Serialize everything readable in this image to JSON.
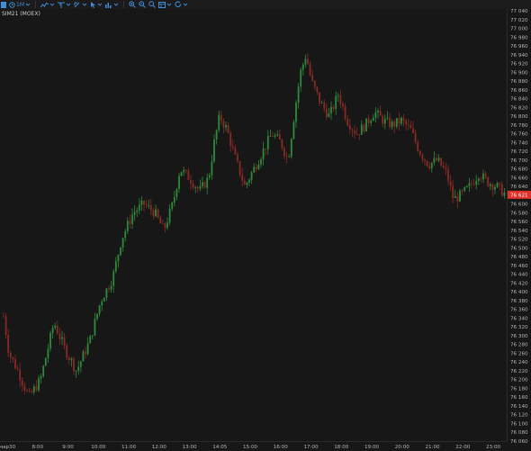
{
  "toolbar": {
    "timeframe_label": "1M",
    "items": [
      {
        "name": "menu-icon"
      },
      {
        "name": "clock-icon"
      },
      {
        "name": "chart-type-icon"
      },
      {
        "name": "indicators-icon"
      },
      {
        "name": "drawing-tools-icon"
      },
      {
        "name": "cursor-icon"
      },
      {
        "name": "volume-bars-icon"
      },
      {
        "name": "zoom-in-icon"
      },
      {
        "name": "zoom-out-icon"
      },
      {
        "name": "search-icon"
      },
      {
        "name": "templates-icon"
      },
      {
        "name": "refresh-icon"
      }
    ]
  },
  "chart": {
    "symbol": "SIM21 (MOEX)",
    "current_price": "76 621",
    "colors": {
      "background": "#171717",
      "up": "#2e8b3c",
      "down": "#8a2a25",
      "price_tag": "#e0302a",
      "axis_text": "#b5b5b5"
    }
  },
  "chart_data": {
    "type": "candlestick",
    "y_range": [
      76060,
      77040
    ],
    "y_ticks": [
      "77 040",
      "77 020",
      "77 000",
      "76 980",
      "76 960",
      "76 940",
      "76 920",
      "76 900",
      "76 880",
      "76 860",
      "76 840",
      "76 820",
      "76 800",
      "76 780",
      "76 760",
      "76 740",
      "76 720",
      "76 700",
      "76 680",
      "76 660",
      "76 640",
      "76 621",
      "76 600",
      "76 580",
      "76 560",
      "76 540",
      "76 520",
      "76 500",
      "76 480",
      "76 460",
      "76 440",
      "76 420",
      "76 400",
      "76 380",
      "76 360",
      "76 340",
      "76 320",
      "76 300",
      "76 280",
      "76 260",
      "76 240",
      "76 220",
      "76 200",
      "76 180",
      "76 160",
      "76 140",
      "76 120",
      "76 100",
      "76 080",
      "76 060"
    ],
    "x_ticks": [
      "мар30",
      "8:00",
      "9:00",
      "10:00",
      "11:00",
      "12:00",
      "13:00",
      "14:05",
      "15:00",
      "16:00",
      "17:00",
      "18:00",
      "19:00",
      "20:00",
      "21:00",
      "22:00",
      "23:00"
    ],
    "price_path": [
      [
        0,
        76400
      ],
      [
        10,
        76260
      ],
      [
        20,
        76220
      ],
      [
        32,
        76160
      ],
      [
        45,
        76200
      ],
      [
        60,
        76330
      ],
      [
        72,
        76270
      ],
      [
        85,
        76220
      ],
      [
        100,
        76290
      ],
      [
        112,
        76380
      ],
      [
        125,
        76430
      ],
      [
        135,
        76520
      ],
      [
        148,
        76580
      ],
      [
        160,
        76600
      ],
      [
        172,
        76580
      ],
      [
        182,
        76540
      ],
      [
        192,
        76600
      ],
      [
        200,
        76680
      ],
      [
        210,
        76660
      ],
      [
        222,
        76630
      ],
      [
        232,
        76660
      ],
      [
        238,
        76740
      ],
      [
        244,
        76800
      ],
      [
        252,
        76770
      ],
      [
        262,
        76700
      ],
      [
        272,
        76640
      ],
      [
        282,
        76680
      ],
      [
        292,
        76720
      ],
      [
        302,
        76760
      ],
      [
        312,
        76740
      ],
      [
        320,
        76700
      ],
      [
        328,
        76820
      ],
      [
        334,
        76900
      ],
      [
        340,
        76940
      ],
      [
        346,
        76880
      ],
      [
        356,
        76830
      ],
      [
        366,
        76800
      ],
      [
        376,
        76850
      ],
      [
        386,
        76790
      ],
      [
        396,
        76760
      ],
      [
        406,
        76780
      ],
      [
        416,
        76810
      ],
      [
        426,
        76790
      ],
      [
        436,
        76780
      ],
      [
        446,
        76790
      ],
      [
        456,
        76770
      ],
      [
        466,
        76720
      ],
      [
        476,
        76690
      ],
      [
        486,
        76700
      ],
      [
        496,
        76670
      ],
      [
        504,
        76610
      ],
      [
        512,
        76620
      ],
      [
        522,
        76640
      ],
      [
        532,
        76670
      ],
      [
        542,
        76650
      ],
      [
        552,
        76640
      ],
      [
        562,
        76621
      ]
    ]
  }
}
